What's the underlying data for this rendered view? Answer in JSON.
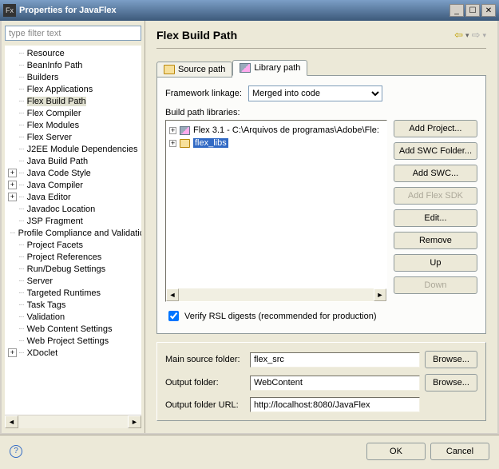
{
  "window": {
    "title": "Properties for JavaFlex",
    "app_icon_text": "Fx"
  },
  "left": {
    "filter_placeholder": "type filter text",
    "items": [
      {
        "label": "Resource",
        "exp": null
      },
      {
        "label": "BeanInfo Path",
        "exp": null
      },
      {
        "label": "Builders",
        "exp": null
      },
      {
        "label": "Flex Applications",
        "exp": null
      },
      {
        "label": "Flex Build Path",
        "exp": null,
        "sel": true
      },
      {
        "label": "Flex Compiler",
        "exp": null
      },
      {
        "label": "Flex Modules",
        "exp": null
      },
      {
        "label": "Flex Server",
        "exp": null
      },
      {
        "label": "J2EE Module Dependencies",
        "exp": null
      },
      {
        "label": "Java Build Path",
        "exp": null
      },
      {
        "label": "Java Code Style",
        "exp": "+"
      },
      {
        "label": "Java Compiler",
        "exp": "+"
      },
      {
        "label": "Java Editor",
        "exp": "+"
      },
      {
        "label": "Javadoc Location",
        "exp": null
      },
      {
        "label": "JSP Fragment",
        "exp": null
      },
      {
        "label": "Profile Compliance and Validatic",
        "exp": null
      },
      {
        "label": "Project Facets",
        "exp": null
      },
      {
        "label": "Project References",
        "exp": null
      },
      {
        "label": "Run/Debug Settings",
        "exp": null
      },
      {
        "label": "Server",
        "exp": null
      },
      {
        "label": "Targeted Runtimes",
        "exp": null
      },
      {
        "label": "Task Tags",
        "exp": null
      },
      {
        "label": "Validation",
        "exp": null
      },
      {
        "label": "Web Content Settings",
        "exp": null
      },
      {
        "label": "Web Project Settings",
        "exp": null
      },
      {
        "label": "XDoclet",
        "exp": "+"
      }
    ]
  },
  "right": {
    "title": "Flex Build Path",
    "tab_source": "Source path",
    "tab_library": "Library path",
    "framework_linkage_label": "Framework linkage:",
    "framework_linkage_value": "Merged into code",
    "build_path_libraries_label": "Build path libraries:",
    "lib_items": [
      {
        "label": "Flex 3.1 - C:\\Arquivos de programas\\Adobe\\Fle:",
        "sel": false,
        "icon": "library"
      },
      {
        "label": "flex_libs",
        "sel": true,
        "icon": "folder"
      }
    ],
    "buttons": {
      "add_project": "Add Project...",
      "add_swc_folder": "Add SWC Folder...",
      "add_swc": "Add SWC...",
      "add_flex_sdk": "Add Flex SDK",
      "edit": "Edit...",
      "remove": "Remove",
      "up": "Up",
      "down": "Down"
    },
    "verify_label": "Verify RSL digests (recommended for production)",
    "main_source_label": "Main source folder:",
    "main_source_value": "flex_src",
    "output_folder_label": "Output folder:",
    "output_folder_value": "WebContent",
    "output_url_label": "Output folder URL:",
    "output_url_value": "http://localhost:8080/JavaFlex",
    "browse": "Browse..."
  },
  "footer": {
    "ok": "OK",
    "cancel": "Cancel"
  }
}
